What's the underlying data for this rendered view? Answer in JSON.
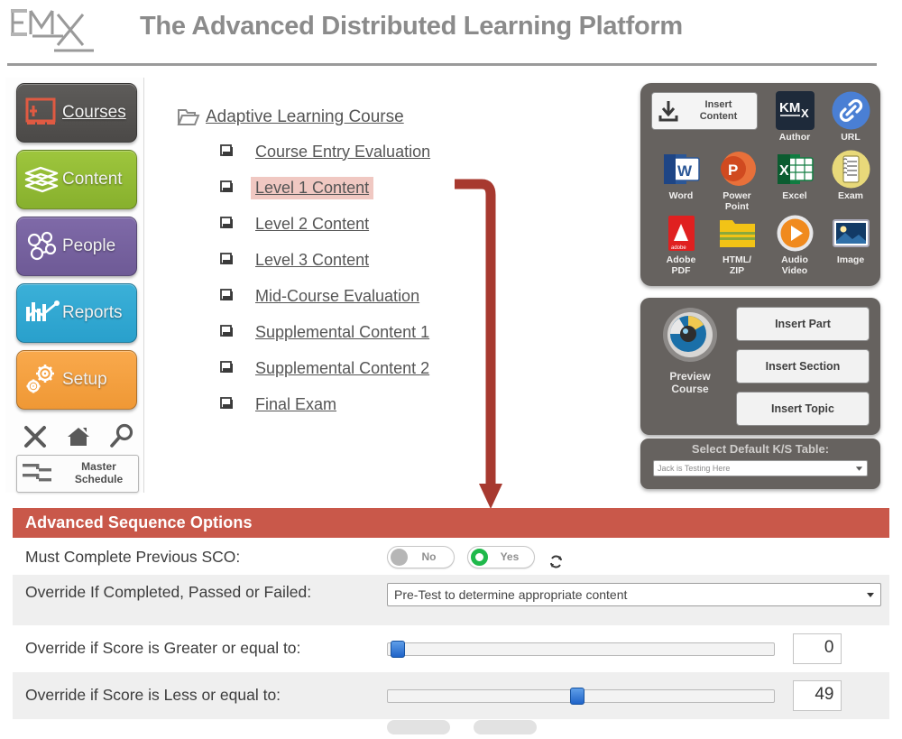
{
  "header": {
    "logo_alt": "KMx",
    "title": "The Advanced Distributed Learning Platform"
  },
  "sidebar": {
    "items": [
      {
        "label": "Courses",
        "color": "#4b4947",
        "icon": "courses-icon"
      },
      {
        "label": "Content",
        "color": "#87b02d",
        "icon": "content-icon"
      },
      {
        "label": "People",
        "color": "#6e5a96",
        "icon": "people-icon"
      },
      {
        "label": "Reports",
        "color": "#29a0cc",
        "icon": "reports-icon"
      },
      {
        "label": "Setup",
        "color": "#ef9835",
        "icon": "setup-icon"
      }
    ],
    "quick_icons": [
      "close-icon",
      "home-icon",
      "search-icon"
    ],
    "master_schedule": {
      "line1": "Master",
      "line2": "Schedule"
    }
  },
  "tree": {
    "root": {
      "label": "Adaptive Learning Course",
      "icon": "open-folder-icon"
    },
    "items": [
      {
        "label": "Course Entry Evaluation",
        "selected": false
      },
      {
        "label": "Level 1 Content",
        "selected": true
      },
      {
        "label": "Level 2 Content",
        "selected": false
      },
      {
        "label": "Level 3 Content",
        "selected": false
      },
      {
        "label": "Mid-Course Evaluation",
        "selected": false
      },
      {
        "label": "Supplemental Content 1",
        "selected": false
      },
      {
        "label": "Supplemental Content 2",
        "selected": false
      },
      {
        "label": "Final Exam",
        "selected": false
      }
    ]
  },
  "tools": {
    "insert_content": {
      "line1": "Insert",
      "line2": "Content",
      "icon": "download-icon"
    },
    "items": [
      {
        "label": "Author",
        "icon": "kmx-author-icon"
      },
      {
        "label": "URL",
        "icon": "link-icon"
      },
      {
        "label": "Word",
        "icon": "word-icon"
      },
      {
        "label": "Power\nPoint",
        "label1": "Power",
        "label2": "Point",
        "icon": "powerpoint-icon"
      },
      {
        "label": "Excel",
        "icon": "excel-icon"
      },
      {
        "label": "Exam",
        "icon": "exam-icon"
      },
      {
        "label": "Adobe\nPDF",
        "label1": "Adobe",
        "label2": "PDF",
        "icon": "pdf-icon"
      },
      {
        "label": "HTML/\nZIP",
        "label1": "HTML/",
        "label2": "ZIP",
        "icon": "html-zip-icon"
      },
      {
        "label": "Audio\nVideo",
        "label1": "Audio",
        "label2": "Video",
        "icon": "audio-video-icon"
      },
      {
        "label": "Image",
        "icon": "image-icon"
      }
    ]
  },
  "preview": {
    "label1": "Preview",
    "label2": "Course",
    "buttons": [
      "Insert Part",
      "Insert Section",
      "Insert Topic"
    ]
  },
  "ks_table": {
    "title": "Select Default K/S Table:",
    "selected": "Jack is Testing Here"
  },
  "aso": {
    "title": "Advanced Sequence Options",
    "accent": "#c9584a",
    "rows": [
      {
        "label": "Must Complete Previous SCO:",
        "type": "toggle",
        "options": [
          {
            "label": "No",
            "state": "off"
          },
          {
            "label": "Yes",
            "state": "on"
          }
        ],
        "refresh_icon": "refresh-icon"
      },
      {
        "label": "Override If Completed, Passed or Failed:",
        "type": "select",
        "value": "Pre-Test to determine appropriate content"
      },
      {
        "label": "Override if Score is Greater or equal to:",
        "type": "slider",
        "value": "0",
        "percent": 1
      },
      {
        "label": "Override if Score is Less or equal to:",
        "type": "slider",
        "value": "49",
        "percent": 49
      }
    ]
  }
}
